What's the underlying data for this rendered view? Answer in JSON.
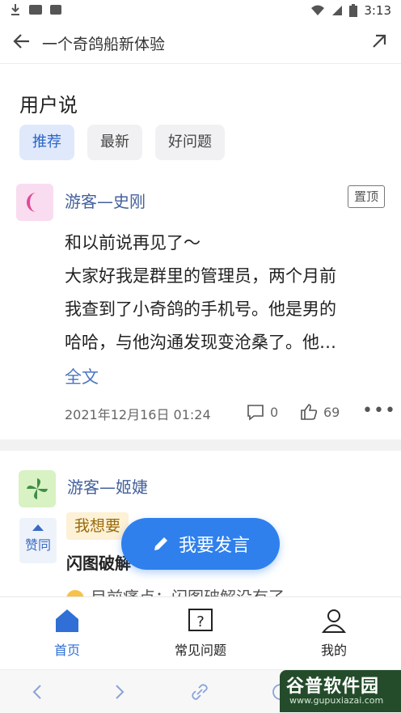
{
  "status_bar": {
    "time": "3:13"
  },
  "top_bar": {
    "title": "一个奇鸽船新体验"
  },
  "section": {
    "title": "用户说"
  },
  "filters": [
    {
      "label": "推荐",
      "active": true
    },
    {
      "label": "最新",
      "active": false
    },
    {
      "label": "好问题",
      "active": false
    }
  ],
  "post1": {
    "user": "游客—史刚",
    "badge": "置顶",
    "lines": [
      "和以前说再见了～",
      "大家好我是群里的管理员，两个月前",
      "我查到了小奇鸽的手机号。他是男的",
      "哈哈，与他沟通发现变沧桑了。他…"
    ],
    "more_link": "全文",
    "date": "2021年12月16日 01:24",
    "comments": "0",
    "likes": "69"
  },
  "post2": {
    "user": "游客—姬婕",
    "vote_label": "赞同",
    "tag": "我想要",
    "title": "闪图破解",
    "snippet": "目前痛点：闪图破解没有了"
  },
  "fab": {
    "label": "我要发言"
  },
  "tabs": [
    {
      "label": "首页",
      "icon": "home-icon",
      "active": true
    },
    {
      "label": "常见问题",
      "icon": "question-icon",
      "active": false
    },
    {
      "label": "我的",
      "icon": "user-icon",
      "active": false
    }
  ],
  "watermark": {
    "main": "谷普软件园",
    "sub": "www.gupuxiazai.com"
  },
  "colors": {
    "accent": "#2f80ed",
    "link": "#4a75c2",
    "chip_active_bg": "#dfe9fb"
  }
}
